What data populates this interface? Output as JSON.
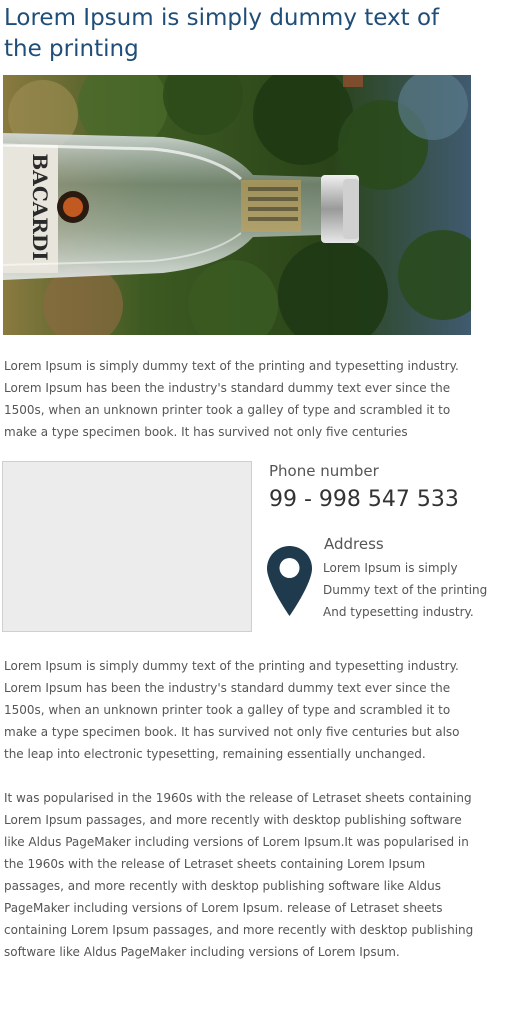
{
  "header": {
    "title": "Lorem Ipsum is simply dummy text of the printing"
  },
  "hero_image": {
    "label_text": "BACARDI"
  },
  "intro": {
    "text": "Lorem Ipsum is simply dummy text of the printing and typesetting industry. Lorem Ipsum has been the industry's standard dummy text ever since the 1500s, when an unknown printer took a galley of type and scrambled it to make a type specimen book. It has survived not only five centuries"
  },
  "contact": {
    "phone_label": "Phone number",
    "phone_number": "99 - 998 547 533",
    "address_label": "Address",
    "address_lines": [
      "Lorem Ipsum is simply",
      "Dummy text of the printing",
      "And typesetting industry."
    ],
    "pin_color": "#1e3a4c"
  },
  "body": {
    "paragraph_1": "Lorem Ipsum is simply dummy text of the printing and typesetting industry. Lorem Ipsum has been the industry's standard dummy text ever since the 1500s, when an unknown printer took a galley of type and scrambled it to make a type specimen book. It has survived not only five centuries but also the leap into electronic typesetting, remaining essentially unchanged.",
    "paragraph_2": "It was popularised in the 1960s with the release of Letraset sheets containing Lorem Ipsum passages, and more recently with desktop publishing software like Aldus PageMaker including versions of Lorem Ipsum.It was popularised in the 1960s with the release of Letraset sheets containing Lorem Ipsum passages, and more recently with desktop publishing software like Aldus PageMaker including versions of Lorem Ipsum. release of Letraset sheets containing Lorem Ipsum passages, and more recently with desktop publishing software like Aldus PageMaker including versions of Lorem Ipsum."
  },
  "colors": {
    "title": "#1f4e79",
    "text": "#555555",
    "map_placeholder": "#ececec"
  }
}
